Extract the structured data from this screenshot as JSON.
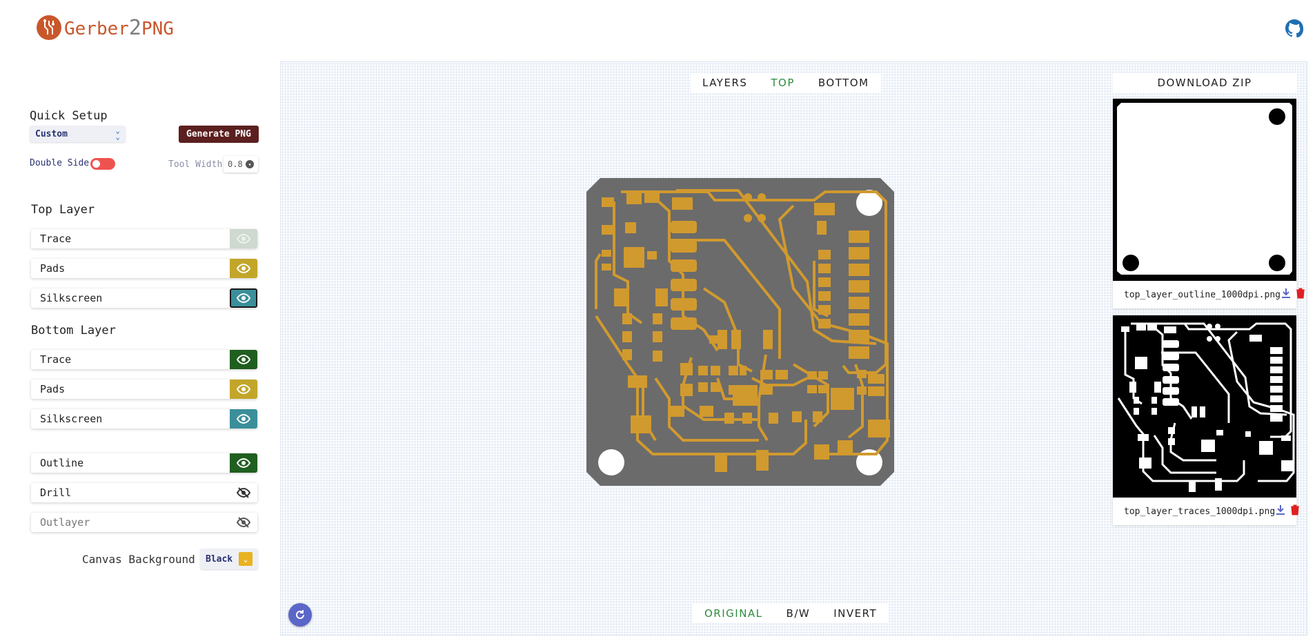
{
  "app": {
    "logo_prefix": "Gerber",
    "logo_two": "2",
    "logo_suffix": "PNG"
  },
  "sidebar": {
    "quick_setup_title": "Quick Setup",
    "preset": "Custom",
    "generate_label": "Generate PNG",
    "double_side_label": "Double Side",
    "double_side_on": false,
    "tool_width_label": "Tool Width",
    "tool_width_value": "0.8",
    "top_layer_title": "Top Layer",
    "top_layers": [
      {
        "label": "Trace",
        "color": "#cfd9cf",
        "visible": true
      },
      {
        "label": "Pads",
        "color": "#c2a62a",
        "visible": true
      },
      {
        "label": "Silkscreen",
        "color": "#3a8f9a",
        "visible": true
      }
    ],
    "bottom_layer_title": "Bottom Layer",
    "bottom_layers": [
      {
        "label": "Trace",
        "color": "#1f5f1f",
        "visible": true
      },
      {
        "label": "Pads",
        "color": "#c2a62a",
        "visible": true
      },
      {
        "label": "Silkscreen",
        "color": "#3a8f9a",
        "visible": true
      }
    ],
    "other_layers": [
      {
        "label": "Outline",
        "color": "#1f5f1f",
        "visible": true
      },
      {
        "label": "Drill",
        "visible": false
      },
      {
        "label": "Outlayer",
        "visible": false
      }
    ],
    "canvas_bg_label": "Canvas Background",
    "canvas_bg_value": "Black"
  },
  "view": {
    "tabs": [
      "LAYERS",
      "TOP",
      "BOTTOM"
    ],
    "active_tab": "TOP",
    "modes": [
      "ORIGINAL",
      "B/W",
      "INVERT"
    ],
    "active_mode": "ORIGINAL"
  },
  "outputs": {
    "download_label": "DOWNLOAD ZIP",
    "files": [
      {
        "name": "top_layer_outline_1000dpi.png"
      },
      {
        "name": "top_layer_traces_1000dpi.png"
      }
    ]
  },
  "colors": {
    "board": "#6b6b6b",
    "copper": "#d19a2e",
    "accent": "#2e8b3e",
    "brand": "#c9572c"
  }
}
